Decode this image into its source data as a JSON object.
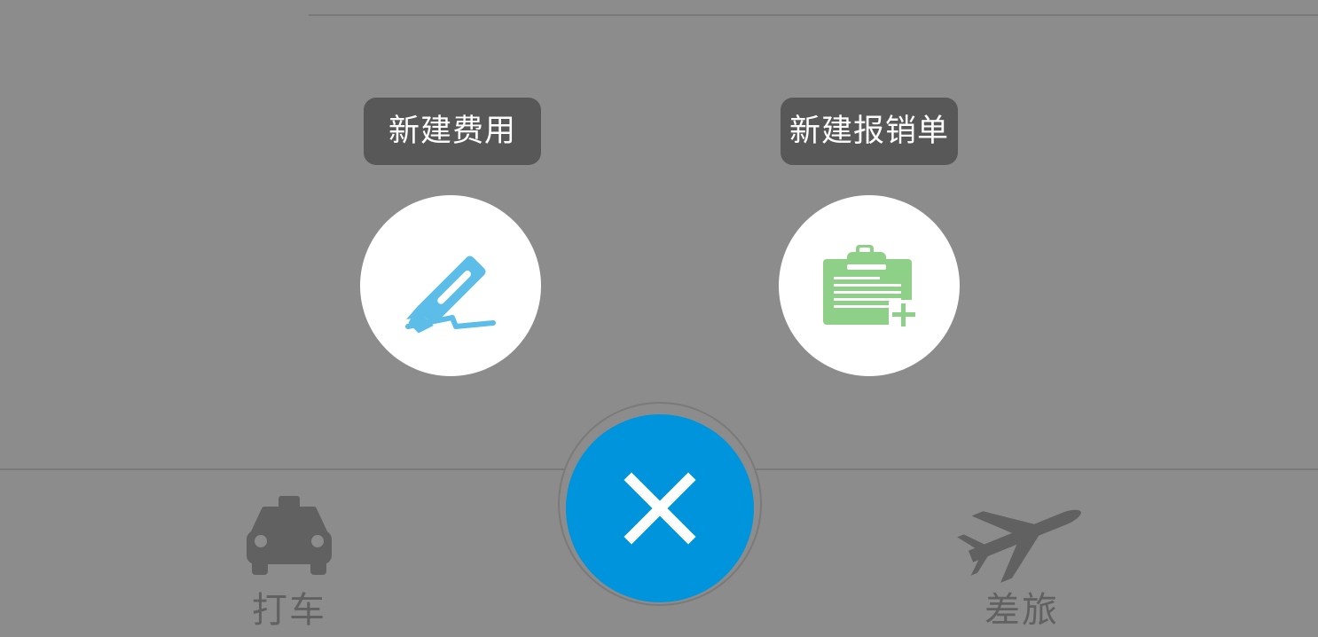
{
  "quick_actions": [
    {
      "tooltip": "新建费用",
      "icon": "pen-icon",
      "icon_color": "#5bbde8"
    },
    {
      "tooltip": "新建报销单",
      "icon": "clipboard-add-icon",
      "icon_color": "#8ed088"
    }
  ],
  "fab": {
    "icon": "close-icon",
    "color": "#0094dc"
  },
  "tab_bar": {
    "items": [
      {
        "label": "打车",
        "icon": "taxi-icon"
      },
      {
        "label": "差旅",
        "icon": "airplane-icon"
      }
    ]
  },
  "colors": {
    "overlay": "#8c8c8c",
    "tooltip_bg": "#585858",
    "tab_inactive": "#616161"
  }
}
